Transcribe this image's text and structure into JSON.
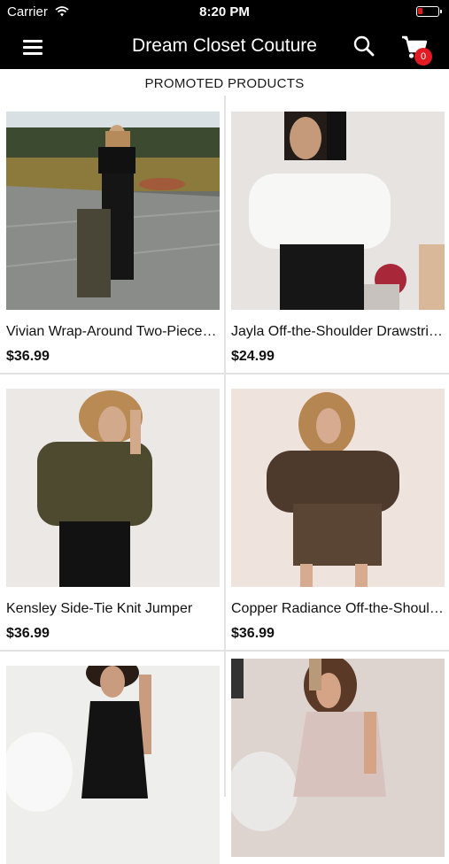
{
  "status_bar": {
    "carrier": "Carrier",
    "time": "8:20 PM",
    "battery_color": "#e01a1a"
  },
  "navbar": {
    "title": "Dream Closet Couture",
    "menu_icon": "hamburger-menu-icon",
    "search_icon": "search-icon",
    "cart_icon": "shopping-cart-icon",
    "cart_count": "0",
    "badge_color": "#e31b23"
  },
  "section": {
    "title": "PROMOTED PRODUCTS"
  },
  "products": [
    {
      "name": "Vivian Wrap-Around Two-Piece Set",
      "price": "$36.99"
    },
    {
      "name": "Jayla Off-the-Shoulder Drawstring Top",
      "price": "$24.99"
    },
    {
      "name": "Kensley Side-Tie Knit Jumper",
      "price": "$36.99"
    },
    {
      "name": "Copper Radiance Off-the-Shoulder Romper",
      "price": "$36.99"
    },
    {
      "name": "",
      "price": ""
    },
    {
      "name": "",
      "price": ""
    }
  ]
}
